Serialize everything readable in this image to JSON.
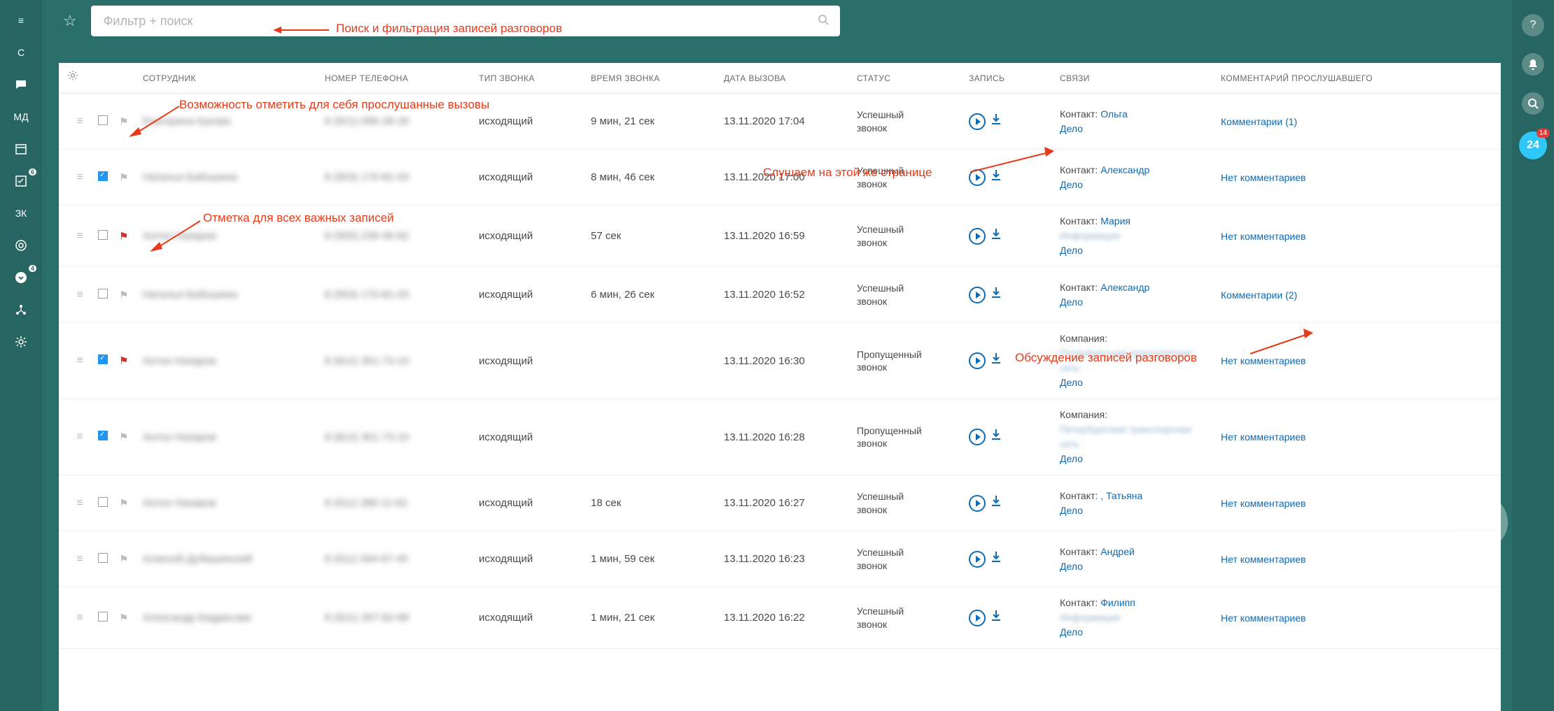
{
  "search": {
    "placeholder": "Фильтр + поиск"
  },
  "leftRail": [
    "С",
    "",
    "МД",
    "",
    "",
    "ЗК",
    "",
    ""
  ],
  "leftRailBadges": {
    "4": "6",
    "7": "4"
  },
  "b24": {
    "label": "24",
    "count": "14"
  },
  "columns": {
    "employee": "СОТРУДНИК",
    "phone": "НОМЕР ТЕЛЕФОНА",
    "callType": "ТИП ЗВОНКА",
    "duration": "ВРЕМЯ ЗВОНКА",
    "date": "ДАТА ВЫЗОВА",
    "status": "СТАТУС",
    "record": "ЗАПИСЬ",
    "relations": "СВЯЗИ",
    "comments": "КОММЕНТАРИЙ ПРОСЛУШАВШЕГО"
  },
  "labels": {
    "contactPrefix": "Контакт: ",
    "companyPrefix": "Компания:",
    "deal": "Дело"
  },
  "annotations": {
    "search": "Поиск и фильтрация записей разговоров",
    "markSelf": "Возможность отметить для себя прослушанные вызовы",
    "listen": "Слушаем на этой же странице",
    "flagAll": "Отметка для всех важных записей",
    "discuss": "Обсуждение записей разговоров"
  },
  "rows": [
    {
      "checked": false,
      "flagged": false,
      "employee": "Екатерина Кукова",
      "phone": "8 (921) 096-28-26",
      "type": "исходящий",
      "duration": "9 мин, 21 сек",
      "date": "13.11.2020 17:04",
      "status": "Успешный звонок",
      "relType": "contact",
      "relName": "Ольга",
      "comments": "Комментарии (1)"
    },
    {
      "checked": true,
      "flagged": false,
      "employee": "Наталья Бабошина",
      "phone": "8 (953) 170-81-03",
      "type": "исходящий",
      "duration": "8 мин, 46 сек",
      "date": "13.11.2020 17:00",
      "status": "Успешный звонок",
      "relType": "contact",
      "relName": "Александр",
      "comments": "Нет комментариев"
    },
    {
      "checked": false,
      "flagged": true,
      "employee": "Антон Назаров",
      "phone": "8 (905) 236-46-82",
      "type": "исходящий",
      "duration": "57 сек",
      "date": "13.11.2020 16:59",
      "status": "Успешный звонок",
      "relType": "contact",
      "relName": "Мария",
      "relExtra": true,
      "comments": "Нет комментариев"
    },
    {
      "checked": false,
      "flagged": false,
      "employee": "Наталья Бабошина",
      "phone": "8 (953) 170-81-03",
      "type": "исходящий",
      "duration": "6 мин, 26 сек",
      "date": "13.11.2020 16:52",
      "status": "Успешный звонок",
      "relType": "contact",
      "relName": "Александр",
      "comments": "Комментарии (2)"
    },
    {
      "checked": true,
      "flagged": true,
      "employee": "Антон Назаров",
      "phone": "8 (812) 301-73-10",
      "type": "исходящий",
      "duration": "",
      "date": "13.11.2020 16:30",
      "status": "Пропущенный звонок",
      "relType": "company",
      "relCompany": "Петербургская транспортная сеть",
      "comments": "Нет комментариев"
    },
    {
      "checked": true,
      "flagged": false,
      "employee": "Антон Назаров",
      "phone": "8 (812) 301-73-10",
      "type": "исходящий",
      "duration": "",
      "date": "13.11.2020 16:28",
      "status": "Пропущенный звонок",
      "relType": "company",
      "relCompany": "Петербургская транспортная сеть",
      "comments": "Нет комментариев"
    },
    {
      "checked": false,
      "flagged": false,
      "employee": "Антон Назаров",
      "phone": "8 (911) 286-11-62",
      "type": "исходящий",
      "duration": "18 сек",
      "date": "13.11.2020 16:27",
      "status": "Успешный звонок",
      "relType": "contact",
      "relName": ", Татьяна",
      "comments": "Нет комментариев"
    },
    {
      "checked": false,
      "flagged": false,
      "employee": "Алексей Дубашинский",
      "phone": "8 (911) 094-67-40",
      "type": "исходящий",
      "duration": "1 мин, 59 сек",
      "date": "13.11.2020 16:23",
      "status": "Успешный звонок",
      "relType": "contact",
      "relName": "Андрей",
      "comments": "Нет комментариев"
    },
    {
      "checked": false,
      "flagged": false,
      "employee": "Александр Бедрисова",
      "phone": "8 (921) 307-82-88",
      "type": "исходящий",
      "duration": "1 мин, 21 сек",
      "date": "13.11.2020 16:22",
      "status": "Успешный звонок",
      "relType": "contact",
      "relName": "Филипп",
      "relExtra": true,
      "comments": "Нет комментариев"
    }
  ]
}
